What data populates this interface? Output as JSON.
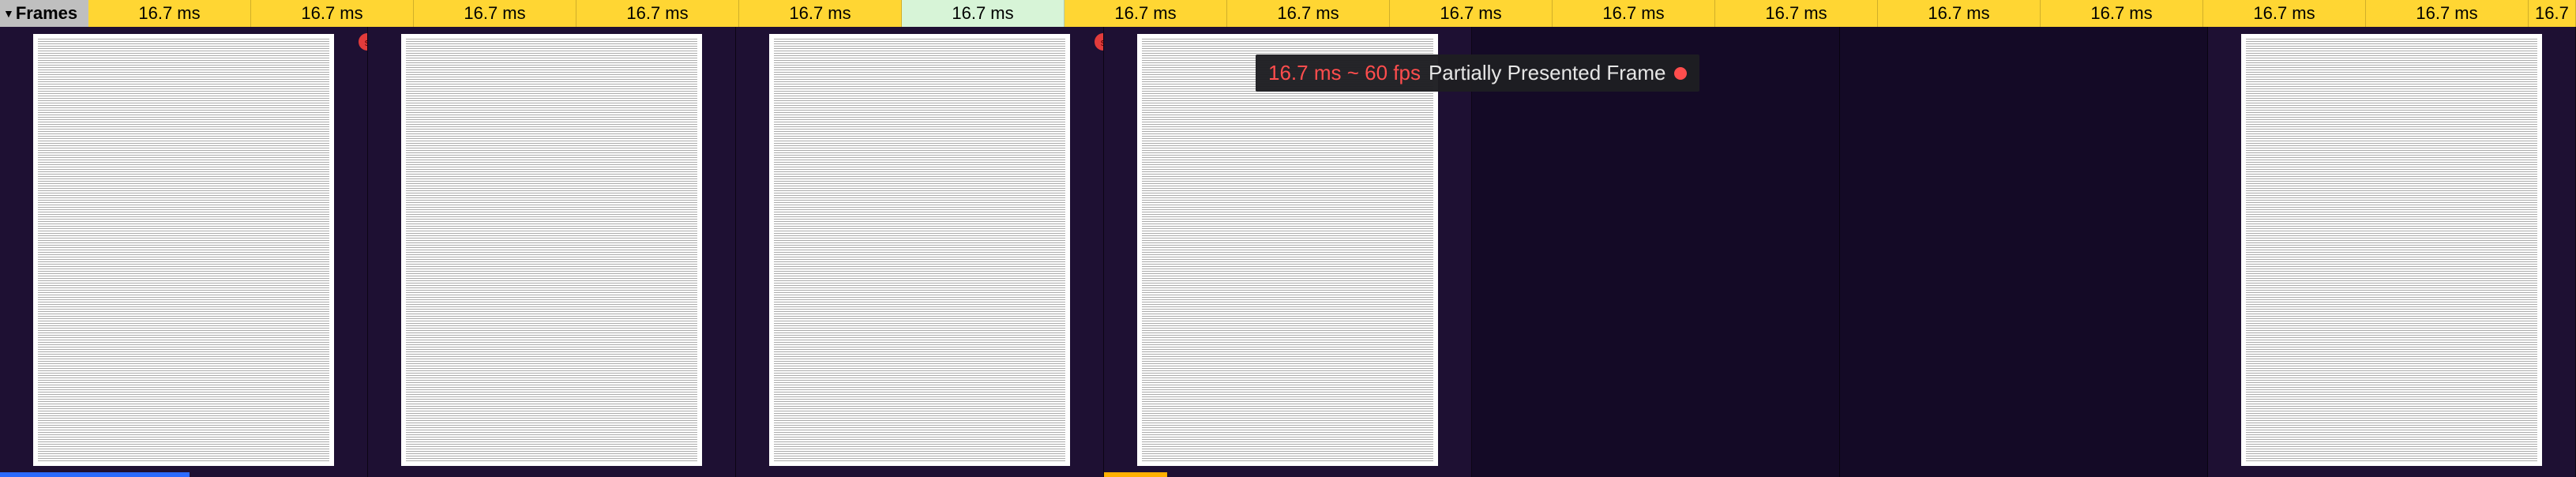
{
  "track_label": "Frames",
  "frame_time_label": "16.7 ms",
  "frames": [
    {
      "color": "yellow"
    },
    {
      "color": "yellow"
    },
    {
      "color": "yellow"
    },
    {
      "color": "yellow"
    },
    {
      "color": "yellow"
    },
    {
      "color": "green"
    },
    {
      "color": "yellow"
    },
    {
      "color": "yellow"
    },
    {
      "color": "yellow"
    },
    {
      "color": "yellow"
    },
    {
      "color": "yellow"
    },
    {
      "color": "yellow"
    },
    {
      "color": "yellow"
    },
    {
      "color": "yellow"
    },
    {
      "color": "yellow"
    },
    {
      "color": "yellow",
      "truncated": true
    }
  ],
  "snapshots": [
    {
      "has_page": true,
      "marker": "right",
      "blue_bar": true
    },
    {
      "has_page": true,
      "marker": null
    },
    {
      "has_page": true,
      "marker": "right"
    },
    {
      "has_page": true,
      "marker": null,
      "orange_bar": true
    },
    {
      "has_page": false,
      "marker": null
    },
    {
      "has_page": false,
      "marker": null
    },
    {
      "has_page": true,
      "marker": null
    }
  ],
  "tooltip": {
    "rate_text": "16.7 ms ~ 60 fps",
    "state_text": "Partially Presented Frame"
  },
  "marker_glyph": "s"
}
